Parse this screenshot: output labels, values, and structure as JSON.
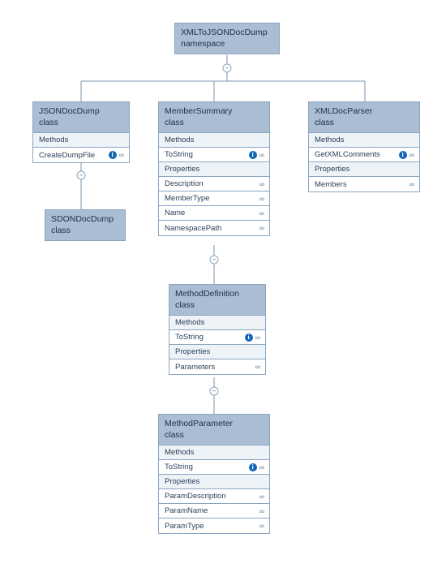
{
  "namespace": {
    "name": "XMLToJSONDocDump",
    "kind": "namespace"
  },
  "classes": {
    "jsondocdump": {
      "name": "JSONDocDump",
      "kind": "class",
      "sections": {
        "methods_label": "Methods",
        "methods": [
          {
            "name": "CreateDumpFile",
            "info": true,
            "view": true
          }
        ]
      }
    },
    "sdondocdump": {
      "name": "SDONDocDump",
      "kind": "class"
    },
    "membersummary": {
      "name": "MemberSummary",
      "kind": "class",
      "sections": {
        "methods_label": "Methods",
        "methods": [
          {
            "name": "ToString",
            "info": true,
            "view": true
          }
        ],
        "properties_label": "Properties",
        "properties": [
          {
            "name": "Description",
            "view": true
          },
          {
            "name": "MemberType",
            "view": true
          },
          {
            "name": "Name",
            "view": true
          },
          {
            "name": "NamespacePath",
            "view": true
          }
        ]
      }
    },
    "xmldocparser": {
      "name": "XMLDocParser",
      "kind": "class",
      "sections": {
        "methods_label": "Methods",
        "methods": [
          {
            "name": "GetXMLComments",
            "info": true,
            "view": true
          }
        ],
        "properties_label": "Properties",
        "properties": [
          {
            "name": "Members",
            "view": true
          }
        ]
      }
    },
    "methoddefinition": {
      "name": "MethodDefinition",
      "kind": "class",
      "sections": {
        "methods_label": "Methods",
        "methods": [
          {
            "name": "ToString",
            "info": true,
            "view": true
          }
        ],
        "properties_label": "Properties",
        "properties": [
          {
            "name": "Parameters",
            "view": true
          }
        ]
      }
    },
    "methodparameter": {
      "name": "MethodParameter",
      "kind": "class",
      "sections": {
        "methods_label": "Methods",
        "methods": [
          {
            "name": "ToString",
            "info": true,
            "view": true
          }
        ],
        "properties_label": "Properties",
        "properties": [
          {
            "name": "ParamDescription",
            "view": true
          },
          {
            "name": "ParamName",
            "view": true
          },
          {
            "name": "ParamType",
            "view": true
          }
        ]
      }
    }
  },
  "chart_data": {
    "type": "diagram",
    "title": "",
    "root": "XMLToJSONDocDump namespace",
    "nodes": [
      {
        "id": "ns",
        "label": "XMLToJSONDocDump",
        "kind": "namespace"
      },
      {
        "id": "JSONDocDump",
        "label": "JSONDocDump",
        "kind": "class",
        "methods": [
          "CreateDumpFile"
        ]
      },
      {
        "id": "SDONDocDump",
        "label": "SDONDocDump",
        "kind": "class"
      },
      {
        "id": "MemberSummary",
        "label": "MemberSummary",
        "kind": "class",
        "methods": [
          "ToString"
        ],
        "properties": [
          "Description",
          "MemberType",
          "Name",
          "NamespacePath"
        ]
      },
      {
        "id": "XMLDocParser",
        "label": "XMLDocParser",
        "kind": "class",
        "methods": [
          "GetXMLComments"
        ],
        "properties": [
          "Members"
        ]
      },
      {
        "id": "MethodDefinition",
        "label": "MethodDefinition",
        "kind": "class",
        "methods": [
          "ToString"
        ],
        "properties": [
          "Parameters"
        ]
      },
      {
        "id": "MethodParameter",
        "label": "MethodParameter",
        "kind": "class",
        "methods": [
          "ToString"
        ],
        "properties": [
          "ParamDescription",
          "ParamName",
          "ParamType"
        ]
      }
    ],
    "edges": [
      {
        "from": "ns",
        "to": "JSONDocDump"
      },
      {
        "from": "ns",
        "to": "MemberSummary"
      },
      {
        "from": "ns",
        "to": "XMLDocParser"
      },
      {
        "from": "JSONDocDump",
        "to": "SDONDocDump"
      },
      {
        "from": "MemberSummary",
        "to": "MethodDefinition"
      },
      {
        "from": "MethodDefinition",
        "to": "MethodParameter"
      }
    ]
  }
}
